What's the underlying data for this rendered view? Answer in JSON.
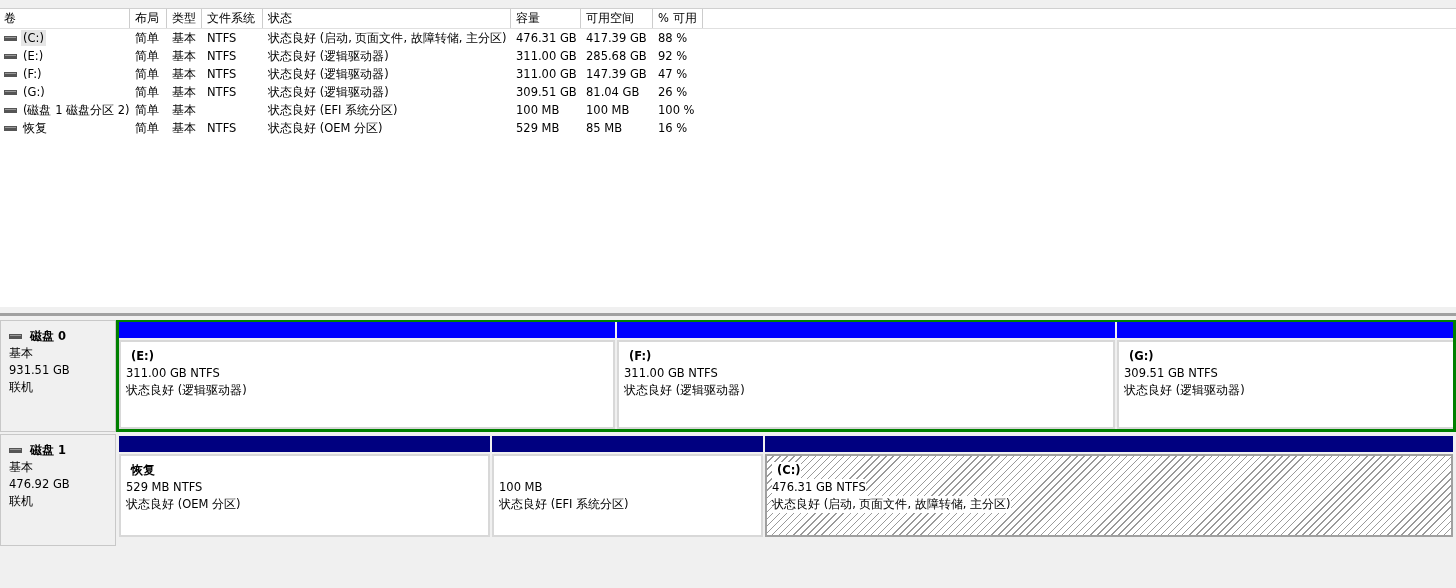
{
  "volume_table": {
    "columns": [
      "卷",
      "布局",
      "类型",
      "文件系统",
      "状态",
      "容量",
      "可用空间",
      "% 可用"
    ],
    "rows": [
      {
        "cells": [
          "(C:)",
          "简单",
          "基本",
          "NTFS",
          "状态良好 (启动, 页面文件, 故障转储, 主分区)",
          "476.31 GB",
          "417.39 GB",
          "88 %"
        ],
        "selected": true
      },
      {
        "cells": [
          "(E:)",
          "简单",
          "基本",
          "NTFS",
          "状态良好 (逻辑驱动器)",
          "311.00 GB",
          "285.68 GB",
          "92 %"
        ],
        "selected": false
      },
      {
        "cells": [
          "(F:)",
          "简单",
          "基本",
          "NTFS",
          "状态良好 (逻辑驱动器)",
          "311.00 GB",
          "147.39 GB",
          "47 %"
        ],
        "selected": false
      },
      {
        "cells": [
          "(G:)",
          "简单",
          "基本",
          "NTFS",
          "状态良好 (逻辑驱动器)",
          "309.51 GB",
          "81.04 GB",
          "26 %"
        ],
        "selected": false
      },
      {
        "cells": [
          "(磁盘 1 磁盘分区 2)",
          "简单",
          "基本",
          "",
          "状态良好 (EFI 系统分区)",
          "100 MB",
          "100 MB",
          "100 %"
        ],
        "selected": false
      },
      {
        "cells": [
          "恢复",
          "简单",
          "基本",
          "NTFS",
          "状态良好 (OEM 分区)",
          "529 MB",
          "85 MB",
          "16 %"
        ],
        "selected": false
      }
    ]
  },
  "disks": [
    {
      "name": "磁盘 0",
      "type": "基本",
      "size": "931.51 GB",
      "status": "联机",
      "selected": true,
      "partitions": [
        {
          "name": "(E:)",
          "size": "311.00 GB NTFS",
          "status": "状态良好 (逻辑驱动器)",
          "color": "#0000ff",
          "selected": false
        },
        {
          "name": "(F:)",
          "size": "311.00 GB NTFS",
          "status": "状态良好 (逻辑驱动器)",
          "color": "#0000ff",
          "selected": false
        },
        {
          "name": "(G:)",
          "size": "309.51 GB NTFS",
          "status": "状态良好 (逻辑驱动器)",
          "color": "#0000ff",
          "selected": false
        }
      ]
    },
    {
      "name": "磁盘 1",
      "type": "基本",
      "size": "476.92 GB",
      "status": "联机",
      "selected": false,
      "partitions": [
        {
          "name": "恢复",
          "size": "529 MB NTFS",
          "status": "状态良好 (OEM 分区)",
          "color": "#000080",
          "selected": false
        },
        {
          "size": "100 MB",
          "status": "状态良好 (EFI 系统分区)",
          "color": "#000080",
          "selected": false
        },
        {
          "name": "(C:)",
          "size": "476.31 GB NTFS",
          "status": "状态良好 (启动, 页面文件, 故障转储, 主分区)",
          "color": "#000080",
          "selected": true
        }
      ]
    }
  ]
}
